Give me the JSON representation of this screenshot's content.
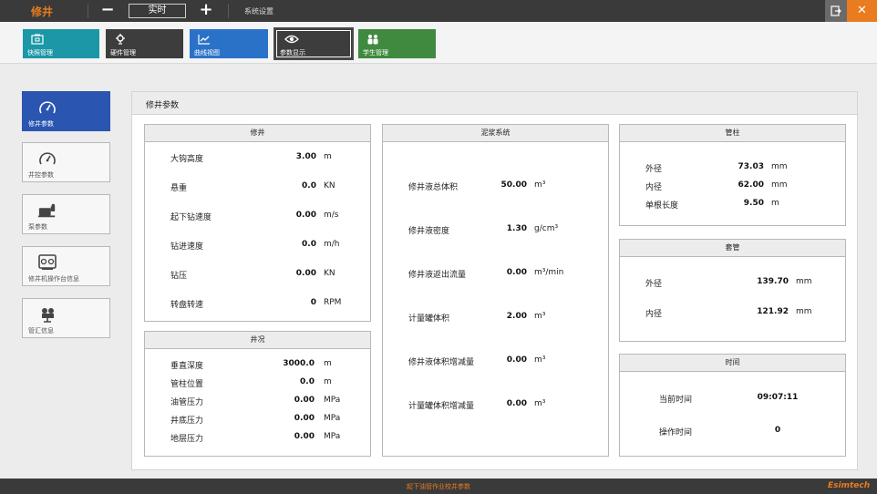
{
  "app": {
    "title": "修井",
    "mode": "实时",
    "minus_symbol": "−",
    "plus_symbol": "+",
    "settings_label": "系统设置",
    "exit_icon": "exit-icon",
    "close_symbol": "✕"
  },
  "toolbar": {
    "buttons": [
      {
        "label": "快照管理",
        "icon": "snapshot-icon",
        "color": "#1b97a7"
      },
      {
        "label": "硬件管理",
        "icon": "hardware-icon",
        "color": "#3d3d3d"
      },
      {
        "label": "曲线视图",
        "icon": "curve-icon",
        "color": "#2a72c8"
      },
      {
        "label": "参数显示",
        "icon": "eye-icon",
        "color": "#3d3d3d"
      },
      {
        "label": "学生管理",
        "icon": "students-icon",
        "color": "#3f8a3f"
      }
    ]
  },
  "nav": {
    "items": [
      {
        "label": "修井参数",
        "icon": "gauge-icon"
      },
      {
        "label": "井控参数",
        "icon": "gauge-icon"
      },
      {
        "label": "泵参数",
        "icon": "pump-icon"
      },
      {
        "label": "修井机操作台信息",
        "icon": "console-icon"
      },
      {
        "label": "管汇信息",
        "icon": "manifold-icon"
      }
    ]
  },
  "main": {
    "title": "修井参数",
    "xiujing": {
      "title": "修井",
      "rows": [
        {
          "label": "大钩高度",
          "value": "3.00",
          "unit": "m"
        },
        {
          "label": "悬重",
          "value": "0.0",
          "unit": "KN"
        },
        {
          "label": "起下钻速度",
          "value": "0.00",
          "unit": "m/s"
        },
        {
          "label": "钻进速度",
          "value": "0.0",
          "unit": "m/h"
        },
        {
          "label": "钻压",
          "value": "0.00",
          "unit": "KN"
        },
        {
          "label": "转盘转速",
          "value": "0",
          "unit": "RPM"
        }
      ]
    },
    "jingkuang": {
      "title": "井况",
      "rows": [
        {
          "label": "垂直深度",
          "value": "3000.0",
          "unit": "m"
        },
        {
          "label": "管柱位置",
          "value": "0.0",
          "unit": "m"
        },
        {
          "label": "油管压力",
          "value": "0.00",
          "unit": "MPa"
        },
        {
          "label": "井底压力",
          "value": "0.00",
          "unit": "MPa"
        },
        {
          "label": "地层压力",
          "value": "0.00",
          "unit": "MPa"
        }
      ]
    },
    "mud": {
      "title": "泥浆系统",
      "rows": [
        {
          "label": "修井液总体积",
          "value": "50.00",
          "unit": "m³"
        },
        {
          "label": "修井液密度",
          "value": "1.30",
          "unit": "g/cm³"
        },
        {
          "label": "修井液返出流量",
          "value": "0.00",
          "unit": "m³/min"
        },
        {
          "label": "计量罐体积",
          "value": "2.00",
          "unit": "m³"
        },
        {
          "label": "修井液体积增减量",
          "value": "0.00",
          "unit": "m³"
        },
        {
          "label": "计量罐体积增减量",
          "value": "0.00",
          "unit": "m³"
        }
      ]
    },
    "tubing": {
      "title": "管柱",
      "rows": [
        {
          "label": "外径",
          "value": "73.03",
          "unit": "mm"
        },
        {
          "label": "内径",
          "value": "62.00",
          "unit": "mm"
        },
        {
          "label": "单根长度",
          "value": "9.50",
          "unit": "m"
        }
      ]
    },
    "casing": {
      "title": "套管",
      "rows": [
        {
          "label": "外径",
          "value": "139.70",
          "unit": "mm"
        },
        {
          "label": "内径",
          "value": "121.92",
          "unit": "mm"
        }
      ]
    },
    "time": {
      "title": "时间",
      "rows": [
        {
          "label": "当前时间",
          "value": "09:07:11"
        },
        {
          "label": "操作时间",
          "value": "0"
        }
      ]
    }
  },
  "status": {
    "text": "起下油管作业校井参数",
    "brand": "Esimtech"
  },
  "colors": {
    "accent": "#e87c1e",
    "nav_active": "#2a55b1",
    "titlebar": "#3a3a3a"
  }
}
